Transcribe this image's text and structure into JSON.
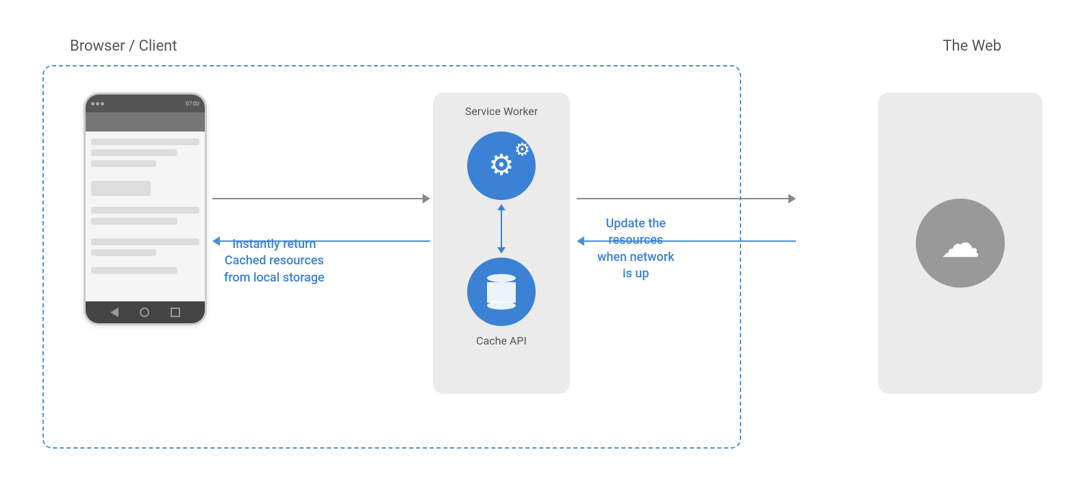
{
  "labels": {
    "browser_client": "Browser / Client",
    "the_web": "The Web",
    "service_worker": "Service Worker",
    "cache_api": "Cache API",
    "instantly_return": "Instantly return",
    "cached_resources": "Cached resources",
    "from_local_storage": "from local storage",
    "update_the": "Update the",
    "resources": "resources",
    "when_network": "when network",
    "is_up": "is up"
  },
  "colors": {
    "blue": "#3b82d4",
    "dashed_border": "#4a90d9",
    "arrow_gray": "#888",
    "box_bg": "#ebebeb",
    "cloud_circle": "#999"
  }
}
